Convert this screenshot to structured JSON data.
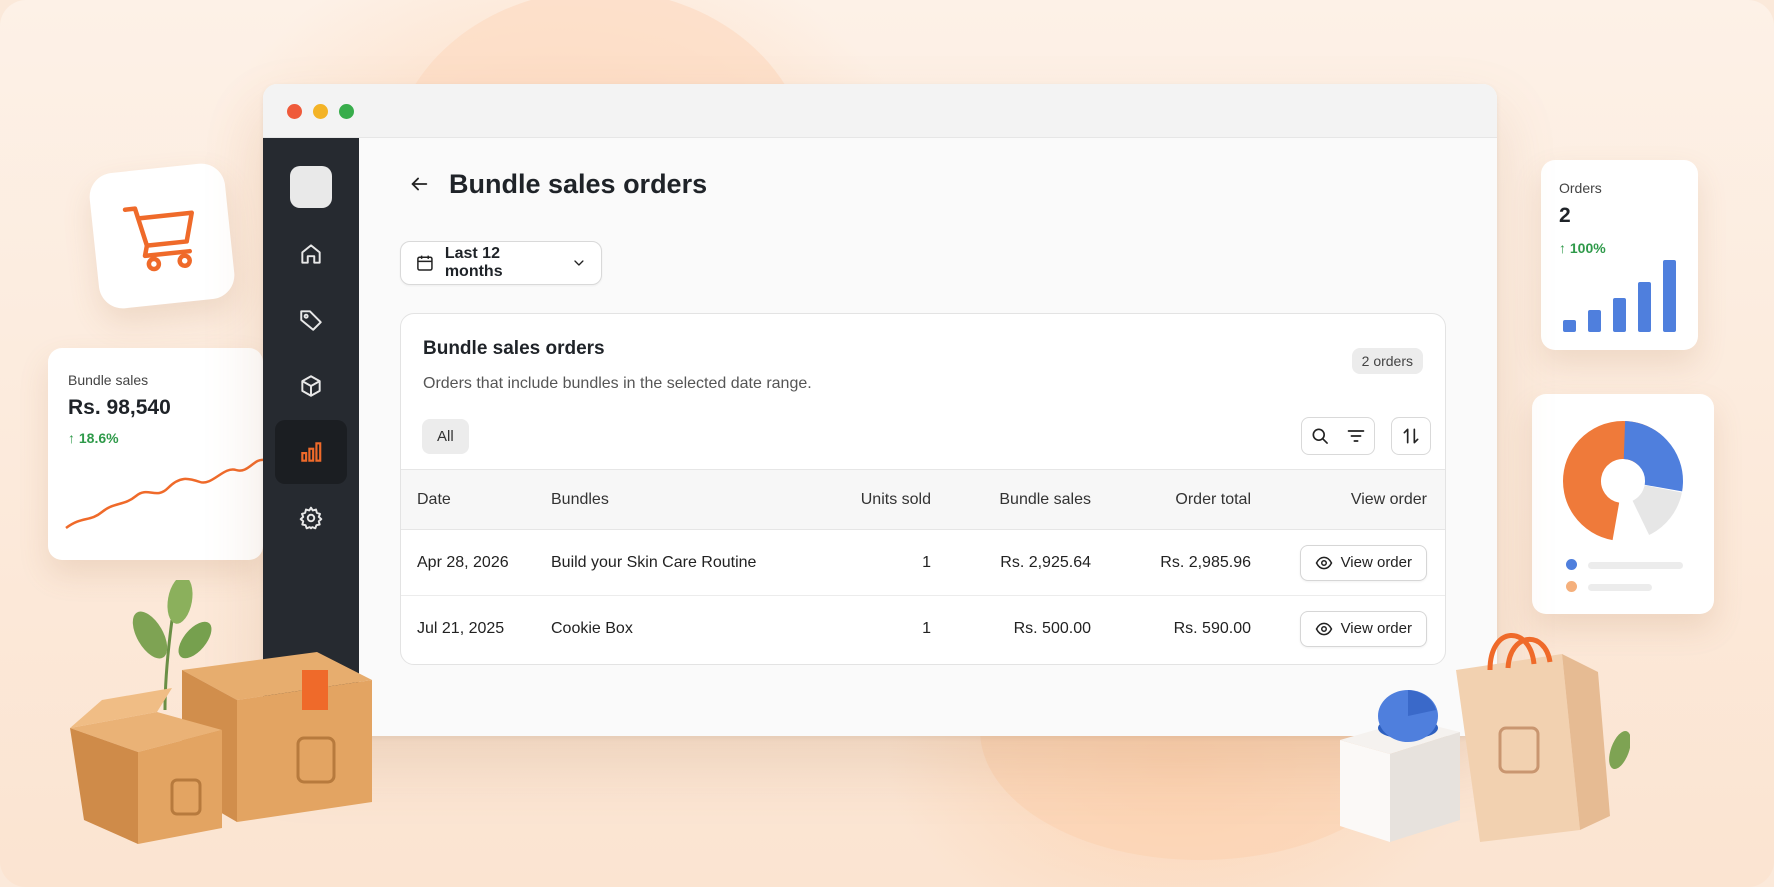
{
  "colors": {
    "accent": "#ef6a2a",
    "sidebar": "#262a30",
    "positive": "#2f9a4a",
    "chart_blue": "#4f7fdd"
  },
  "window": {
    "controls": [
      "close",
      "minimize",
      "maximize"
    ]
  },
  "sidebar": {
    "items": [
      {
        "icon": "home-icon"
      },
      {
        "icon": "tag-icon"
      },
      {
        "icon": "box-icon"
      },
      {
        "icon": "bar-chart-icon",
        "active": true
      },
      {
        "icon": "gear-icon"
      }
    ]
  },
  "header": {
    "title": "Bundle sales orders",
    "back_icon": "arrow-left-icon"
  },
  "date_filter": {
    "label": "Last 12 months"
  },
  "card": {
    "title": "Bundle sales orders",
    "subtitle": "Orders that include bundles in the selected date range.",
    "badge": "2 orders",
    "filter_chip": "All"
  },
  "table": {
    "headers": [
      "Date",
      "Bundles",
      "Units sold",
      "Bundle sales",
      "Order total",
      "View order"
    ],
    "rows": [
      {
        "date": "Apr 28, 2026",
        "bundle": "Build your Skin Care Routine",
        "units": "1",
        "sales": "Rs. 2,925.64",
        "total": "Rs. 2,985.96",
        "action": "View order"
      },
      {
        "date": "Jul 21, 2025",
        "bundle": "Cookie Box",
        "units": "1",
        "sales": "Rs. 500.00",
        "total": "Rs. 590.00",
        "action": "View order"
      }
    ]
  },
  "widgets": {
    "bundle_sales": {
      "label": "Bundle sales",
      "value": "Rs. 98,540",
      "change": "↑ 18.6%"
    },
    "orders": {
      "label": "Orders",
      "value": "2",
      "change": "↑ 100%"
    }
  }
}
